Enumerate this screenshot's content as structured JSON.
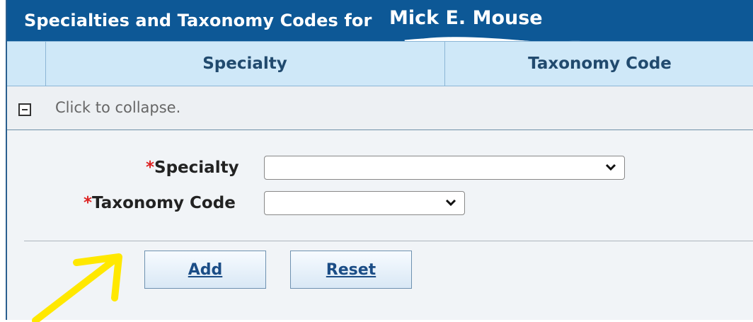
{
  "title": "Specialties and Taxonomy Codes for",
  "provider_name": "Mick E. Mouse",
  "columns": [
    "Specialty",
    "Taxonomy Code"
  ],
  "collapse_text": "Click to collapse.",
  "form": {
    "specialty_label": "Specialty",
    "taxonomy_label": "Taxonomy Code",
    "required_mark": "*",
    "specialty_value": "",
    "taxonomy_value": ""
  },
  "buttons": {
    "add": "Add",
    "reset": "Reset"
  },
  "colors": {
    "title_bg": "#0d5896",
    "header_bg": "#cfe8f8",
    "annotation": "#ffe800"
  }
}
